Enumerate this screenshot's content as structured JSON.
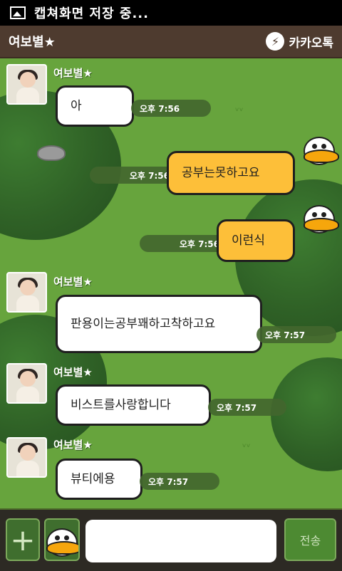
{
  "status_bar": {
    "text": "캡쳐화면 저장 중..."
  },
  "header": {
    "title": "여보별★",
    "brand": "카카오톡"
  },
  "messages": [
    {
      "type": "in",
      "sender": "여보별★",
      "text": "아",
      "time": "오후 7:56"
    },
    {
      "type": "out",
      "text": "공부는못하고요",
      "time": "오후 7:56"
    },
    {
      "type": "out",
      "text": "이런식",
      "time": "오후 7:56"
    },
    {
      "type": "in",
      "sender": "여보별★",
      "text": "판용이는공부꽤하고착하고요",
      "time": "오후 7:57"
    },
    {
      "type": "in",
      "sender": "여보별★",
      "text": "비스트를사랑합니다",
      "time": "오후 7:57"
    },
    {
      "type": "in",
      "sender": "여보별★",
      "text": "뷰티에용",
      "time": "오후 7:57"
    }
  ],
  "input_bar": {
    "message_placeholder": "",
    "send_label": "전송"
  },
  "colors": {
    "header": "#4e3b2f",
    "grass": "#67a43d",
    "bubble_out": "#fdbf39",
    "bubble_in": "#ffffff"
  },
  "icons": {
    "status": "image-icon",
    "brand": "kakao-talk-icon",
    "plus": "plus-icon",
    "emoticon": "duck-emoticon-icon"
  }
}
